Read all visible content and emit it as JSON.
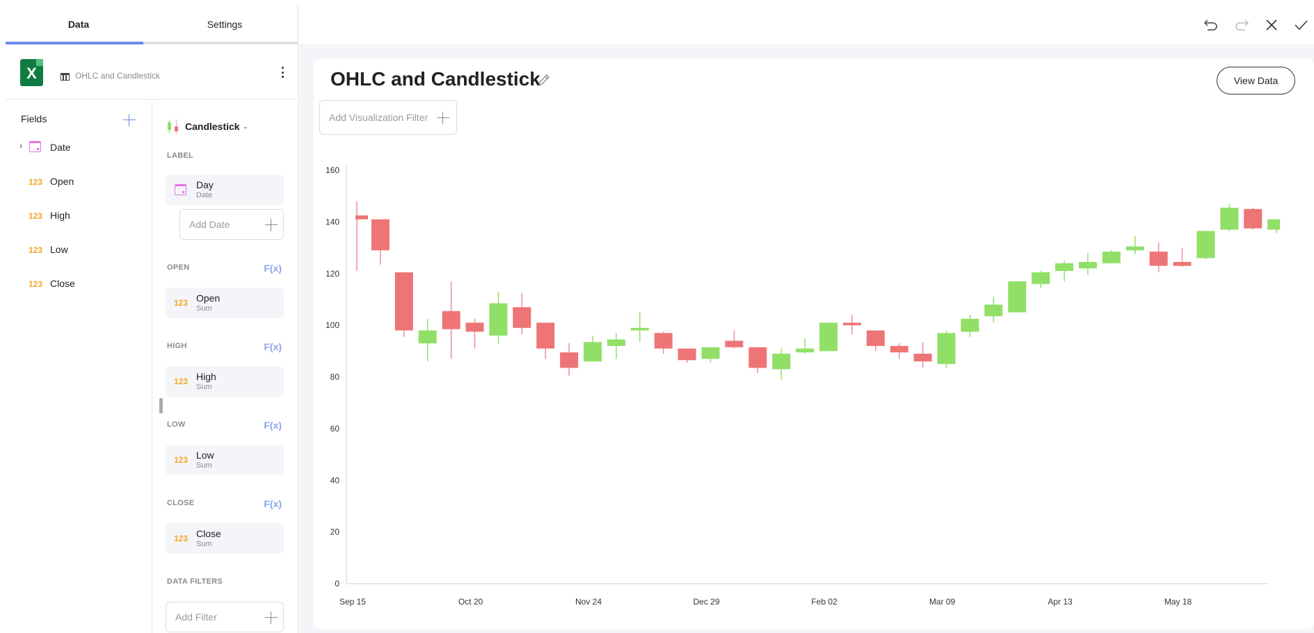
{
  "left_panel": {
    "tabs": [
      {
        "label": "Data",
        "active": true
      },
      {
        "label": "Settings",
        "active": false
      }
    ],
    "source": {
      "icon": "excel-icon",
      "excel_letter": "X",
      "table_icon": "table-icon",
      "name": "OHLC and Candlestick"
    },
    "fields": {
      "title": "Fields",
      "items": [
        {
          "label": "Date",
          "icon": "calendar-icon",
          "expandable": true
        },
        {
          "label": "Open",
          "icon": "123"
        },
        {
          "label": "High",
          "icon": "123"
        },
        {
          "label": "Low",
          "icon": "123"
        },
        {
          "label": "Close",
          "icon": "123"
        }
      ]
    },
    "config": {
      "visualization": "Candlestick",
      "label_section": {
        "title": "LABEL",
        "pill": {
          "title": "Day",
          "sub": "Date"
        },
        "add_placeholder": "Add Date"
      },
      "open_section": {
        "title": "OPEN",
        "fx": "F(x)",
        "pill": {
          "icon": "123",
          "title": "Open",
          "sub": "Sum"
        }
      },
      "high_section": {
        "title": "HIGH",
        "fx": "F(x)",
        "pill": {
          "icon": "123",
          "title": "High",
          "sub": "Sum"
        }
      },
      "low_section": {
        "title": "LOW",
        "fx": "F(x)",
        "pill": {
          "icon": "123",
          "title": "Low",
          "sub": "Sum"
        }
      },
      "close_section": {
        "title": "CLOSE",
        "fx": "F(x)",
        "pill": {
          "icon": "123",
          "title": "Close",
          "sub": "Sum"
        }
      },
      "filters_section": {
        "title": "DATA FILTERS",
        "add_placeholder": "Add Filter"
      }
    }
  },
  "toolbar": {
    "buttons": [
      "undo-icon",
      "redo-icon",
      "close-icon",
      "check-icon"
    ]
  },
  "main": {
    "title": "OHLC and Candlestick",
    "add_viz_filter": "Add Visualization Filter",
    "view_data_label": "View Data"
  },
  "colors": {
    "accent": "#6c8ae8",
    "up": "#92df68",
    "down": "#ee7575",
    "down_wick": "#f08aa0",
    "number_icon": "#f5a623",
    "date_icon": "#e86fe2"
  },
  "chart_data": {
    "type": "candlestick",
    "title": "OHLC and Candlestick",
    "xlabel": "",
    "ylabel": "",
    "ylim": [
      0,
      160
    ],
    "yticks": [
      0,
      20,
      40,
      60,
      80,
      100,
      120,
      140,
      160
    ],
    "xtick_labels": [
      {
        "label": "Sep 15",
        "index": 0
      },
      {
        "label": "Oct 20",
        "index": 5
      },
      {
        "label": "Nov 24",
        "index": 10
      },
      {
        "label": "Dec 29",
        "index": 15
      },
      {
        "label": "Feb 02",
        "index": 20
      },
      {
        "label": "Mar 09",
        "index": 25
      },
      {
        "label": "Apr 13",
        "index": 30
      },
      {
        "label": "May 18",
        "index": 35
      }
    ],
    "grid": false,
    "series": [
      {
        "o": 142.5,
        "h": 148,
        "l": 121,
        "c": 141
      },
      {
        "o": 141,
        "h": 141,
        "l": 123.5,
        "c": 129
      },
      {
        "o": 120.5,
        "h": 120.5,
        "l": 95.5,
        "c": 98
      },
      {
        "o": 93,
        "h": 102.5,
        "l": 86,
        "c": 98
      },
      {
        "o": 105.5,
        "h": 117,
        "l": 87,
        "c": 98.5
      },
      {
        "o": 101,
        "h": 102.5,
        "l": 91,
        "c": 97.5
      },
      {
        "o": 96,
        "h": 113,
        "l": 93,
        "c": 108.5
      },
      {
        "o": 107,
        "h": 112.5,
        "l": 96.5,
        "c": 99
      },
      {
        "o": 101,
        "h": 101,
        "l": 87,
        "c": 91
      },
      {
        "o": 89.5,
        "h": 93,
        "l": 80.5,
        "c": 83.5
      },
      {
        "o": 86,
        "h": 96,
        "l": 86,
        "c": 93.5
      },
      {
        "o": 92,
        "h": 97,
        "l": 87,
        "c": 94.5
      },
      {
        "o": 98,
        "h": 105,
        "l": 93.5,
        "c": 99
      },
      {
        "o": 97,
        "h": 97.5,
        "l": 89,
        "c": 91
      },
      {
        "o": 91,
        "h": 91,
        "l": 85.5,
        "c": 86.5
      },
      {
        "o": 87,
        "h": 91.5,
        "l": 85.5,
        "c": 91.5
      },
      {
        "o": 94,
        "h": 98,
        "l": 91,
        "c": 91.5
      },
      {
        "o": 91.5,
        "h": 91.5,
        "l": 81.5,
        "c": 83.5
      },
      {
        "o": 83,
        "h": 91,
        "l": 79,
        "c": 89
      },
      {
        "o": 89.5,
        "h": 95,
        "l": 89,
        "c": 91
      },
      {
        "o": 90,
        "h": 101,
        "l": 90,
        "c": 101
      },
      {
        "o": 101,
        "h": 104,
        "l": 96.5,
        "c": 100
      },
      {
        "o": 98,
        "h": 98,
        "l": 90,
        "c": 92
      },
      {
        "o": 92,
        "h": 93,
        "l": 87,
        "c": 89.5
      },
      {
        "o": 89,
        "h": 93.5,
        "l": 83.5,
        "c": 86
      },
      {
        "o": 85,
        "h": 98,
        "l": 83.5,
        "c": 97
      },
      {
        "o": 97.5,
        "h": 104,
        "l": 95.5,
        "c": 102.5
      },
      {
        "o": 103.5,
        "h": 111,
        "l": 101,
        "c": 108
      },
      {
        "o": 105,
        "h": 117,
        "l": 105,
        "c": 117
      },
      {
        "o": 116,
        "h": 121,
        "l": 114.5,
        "c": 120.5
      },
      {
        "o": 121,
        "h": 125,
        "l": 117,
        "c": 124
      },
      {
        "o": 122,
        "h": 128,
        "l": 119.5,
        "c": 124.5
      },
      {
        "o": 124,
        "h": 129,
        "l": 124,
        "c": 128.5
      },
      {
        "o": 129,
        "h": 134.5,
        "l": 127.5,
        "c": 130.5
      },
      {
        "o": 128.5,
        "h": 132,
        "l": 120.5,
        "c": 123
      },
      {
        "o": 124.5,
        "h": 130,
        "l": 122.5,
        "c": 123
      },
      {
        "o": 126,
        "h": 136.5,
        "l": 125.5,
        "c": 136.5
      },
      {
        "o": 137,
        "h": 147,
        "l": 136.5,
        "c": 145.5
      },
      {
        "o": 145,
        "h": 145.5,
        "l": 137,
        "c": 137.5
      },
      {
        "o": 137,
        "h": 141,
        "l": 135.5,
        "c": 141
      }
    ]
  }
}
